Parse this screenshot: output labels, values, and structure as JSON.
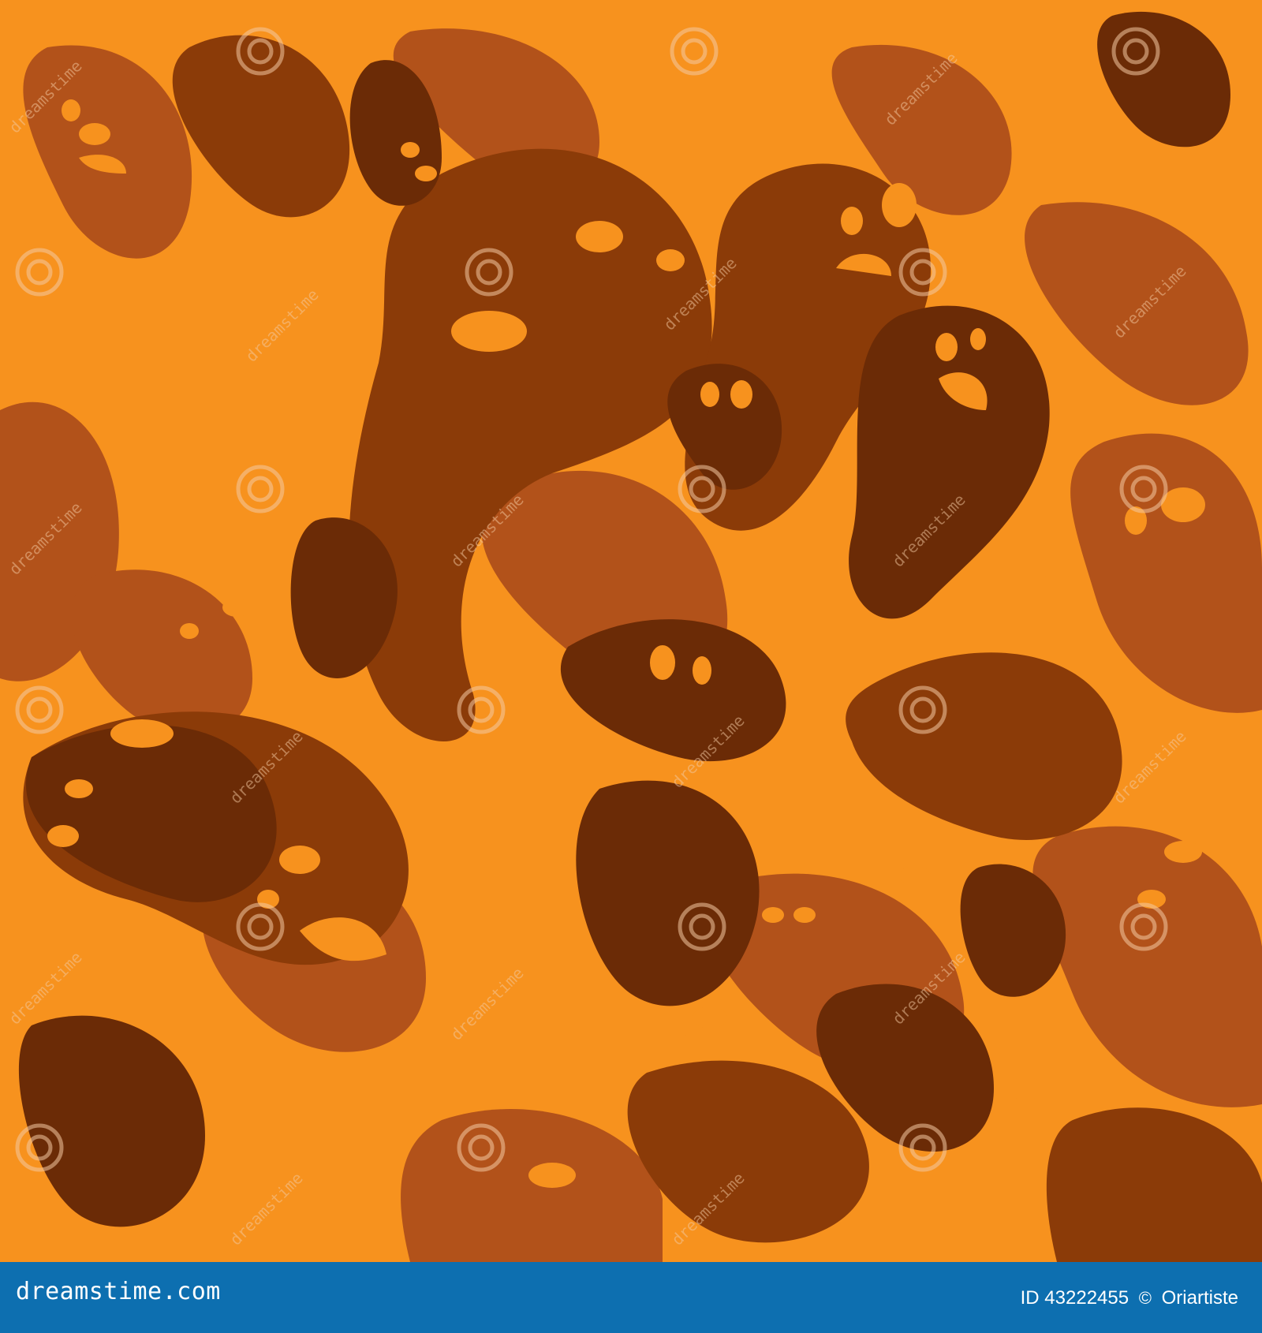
{
  "artwork": {
    "subject": "halloween-ghost-pattern",
    "colors": {
      "background": "#f7921e",
      "ghost_dark": "#6b2b06",
      "ghost_mid": "#8b3b08",
      "ghost_light": "#b2521a",
      "ghost_eyes": "#f7921e"
    },
    "watermark": "dreamstime"
  },
  "footer": {
    "brand": "dreamstime.com",
    "id_prefix": "ID",
    "id_number": "43222455",
    "copyright_symbol": "©",
    "author": "Oriartiste",
    "background": "#0d6fb0"
  }
}
